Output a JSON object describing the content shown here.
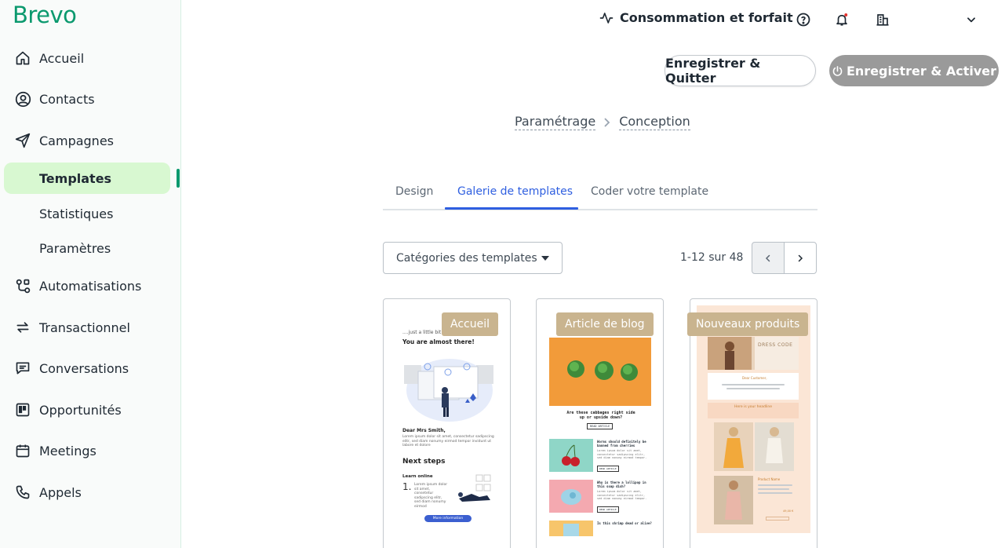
{
  "brand": {
    "name": "Brevo",
    "color": "#0b996e"
  },
  "sidebar": {
    "items": [
      {
        "label": "Accueil",
        "icon": "home-icon"
      },
      {
        "label": "Contacts",
        "icon": "contacts-icon"
      },
      {
        "label": "Campagnes",
        "icon": "send-icon"
      },
      {
        "label": "Templates",
        "icon": "",
        "active": true
      },
      {
        "label": "Statistiques",
        "icon": ""
      },
      {
        "label": "Paramètres",
        "icon": ""
      },
      {
        "label": "Automatisations",
        "icon": "automation-icon"
      },
      {
        "label": "Transactionnel",
        "icon": "transfer-icon"
      },
      {
        "label": "Conversations",
        "icon": "chat-icon"
      },
      {
        "label": "Opportunités",
        "icon": "kanban-icon"
      },
      {
        "label": "Meetings",
        "icon": "calendar-icon"
      },
      {
        "label": "Appels",
        "icon": "phone-icon"
      }
    ]
  },
  "header": {
    "consumption_label": "Consommation et forfait",
    "icons": [
      "help-icon",
      "bell-icon",
      "building-icon",
      "chevron-down-icon"
    ]
  },
  "actions": {
    "save_quit": "Enregistrer & Quitter",
    "save_activate": "Enregistrer & Activer"
  },
  "breadcrumb": [
    "Paramétrage",
    "Conception"
  ],
  "tabs": [
    {
      "label": "Design",
      "active": false
    },
    {
      "label": "Galerie de templates",
      "active": true
    },
    {
      "label": "Coder votre template",
      "active": false
    }
  ],
  "filters": {
    "category_select": "Catégories des templates",
    "pagination": "1-12 sur 48"
  },
  "templates": [
    {
      "tag": "Accueil",
      "preview": {
        "intro": "....just a little bit m",
        "heading": "You are almost there!",
        "greeting": "Dear Mrs Smith,",
        "body": "Lorem ipsum dolor sit amet, consectetur sadipscing elitr, sed diam nonumy eirmod tempor invidunt ut labore et dolore",
        "next_steps": "Next steps",
        "step_title": "Learn online",
        "step_number": "1.",
        "step_text": "Lorem ipsum dolor sit amet, consetetur sadipscing elitr, sed diam nonumy eirmod",
        "cta": "More information"
      }
    },
    {
      "tag": "Article de blog",
      "preview": {
        "headline": "Are these cabbages right side up or upside down?",
        "btn": "READ ARTICLE",
        "item1_title": "Worms should definitely be banned from cherries",
        "item2_title": "Why is there a lollipop in this soap dish?",
        "item3_title": "Is this shrimp dead or alive?",
        "item_text": "Lorem ipsum dolor sit amet, consectetur sadipscing elitr, sed diam nonumy eirmod tempor.",
        "item_btn": "READ ARTICLE"
      }
    },
    {
      "tag": "Nouveaux produits",
      "preview": {
        "hero_title": "DRESS CODE",
        "greeting": "Dear Customer,",
        "section": "Here is your headline",
        "product": "Product Name",
        "price": "49,00 €"
      }
    }
  ]
}
